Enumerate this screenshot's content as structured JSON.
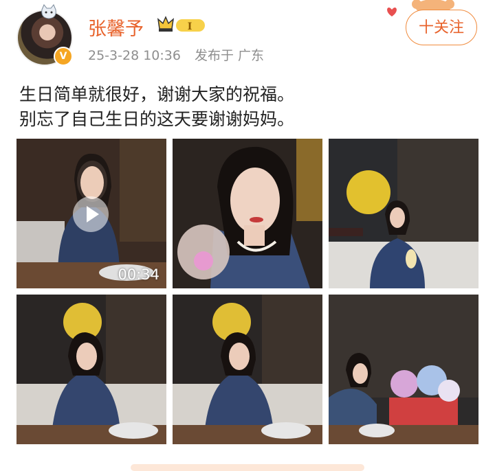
{
  "post": {
    "username": "张馨予",
    "badge_level": "I",
    "timestamp": "25-3-28 10:36",
    "location": "发布于 广东",
    "follow_label": "十关注",
    "content_line1": "生日简单就很好，谢谢大家的祝福。",
    "content_line2": "别忘了自己生日的这天要谢谢妈妈。",
    "video_duration": "00:34"
  },
  "colors": {
    "accent": "#e8632c",
    "verified": "#f5a623",
    "meta": "#8e8e8e"
  },
  "icons": [
    "cat-icon",
    "verified-icon",
    "crown-icon",
    "heart-icon",
    "play-icon"
  ]
}
